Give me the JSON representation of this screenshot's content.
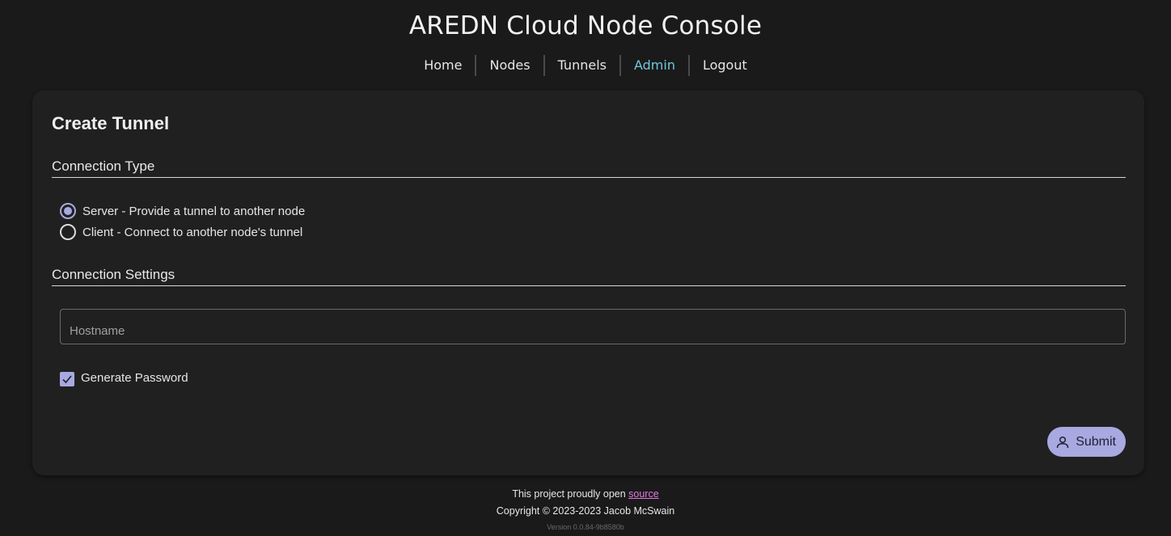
{
  "app": {
    "title": "AREDN Cloud Node Console"
  },
  "nav": {
    "items": [
      {
        "label": "Home",
        "active": false
      },
      {
        "label": "Nodes",
        "active": false
      },
      {
        "label": "Tunnels",
        "active": false
      },
      {
        "label": "Admin",
        "active": true
      },
      {
        "label": "Logout",
        "active": false
      }
    ],
    "active_color": "#6fc7dd"
  },
  "form": {
    "title": "Create Tunnel",
    "connection_type": {
      "heading": "Connection Type",
      "options": [
        {
          "label": "Server - Provide a tunnel to another node",
          "checked": true
        },
        {
          "label": "Client - Connect to another node's tunnel",
          "checked": false
        }
      ]
    },
    "connection_settings": {
      "heading": "Connection Settings",
      "hostname": {
        "placeholder": "Hostname",
        "value": ""
      },
      "generate_password": {
        "label": "Generate Password",
        "checked": true
      }
    },
    "submit": {
      "label": "Submit",
      "icon": "user-icon"
    }
  },
  "footer": {
    "line1_text": "This project proudly open",
    "source_link": "source",
    "copyright": "Copyright © 2023-2023 Jacob McSwain",
    "version": "Version 0.0.84-9b8580b"
  },
  "colors": {
    "background": "#1a1a1a",
    "card": "#202020",
    "accent": "#a8a9e0",
    "link": "#e07be0"
  }
}
